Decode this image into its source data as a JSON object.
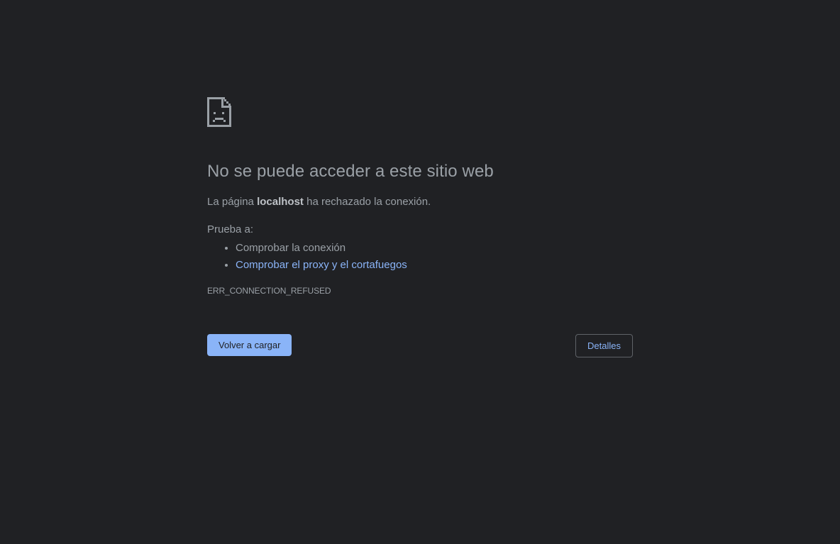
{
  "icon": "sad-document-icon",
  "colors": {
    "background": "#202124",
    "text": "#9aa0a6",
    "link": "#8ab4f8",
    "primary_button": "#8ab4f8"
  },
  "error": {
    "heading": "No se puede acceder a este sitio web",
    "summary_prefix": "La página ",
    "summary_host": "localhost",
    "summary_suffix": " ha rechazado la conexión.",
    "suggestions_label": "Prueba a:",
    "suggestions": [
      "Comprobar la conexión",
      "Comprobar el proxy y el cortafuegos"
    ],
    "code": "ERR_CONNECTION_REFUSED"
  },
  "buttons": {
    "reload": "Volver a cargar",
    "details": "Detalles"
  }
}
